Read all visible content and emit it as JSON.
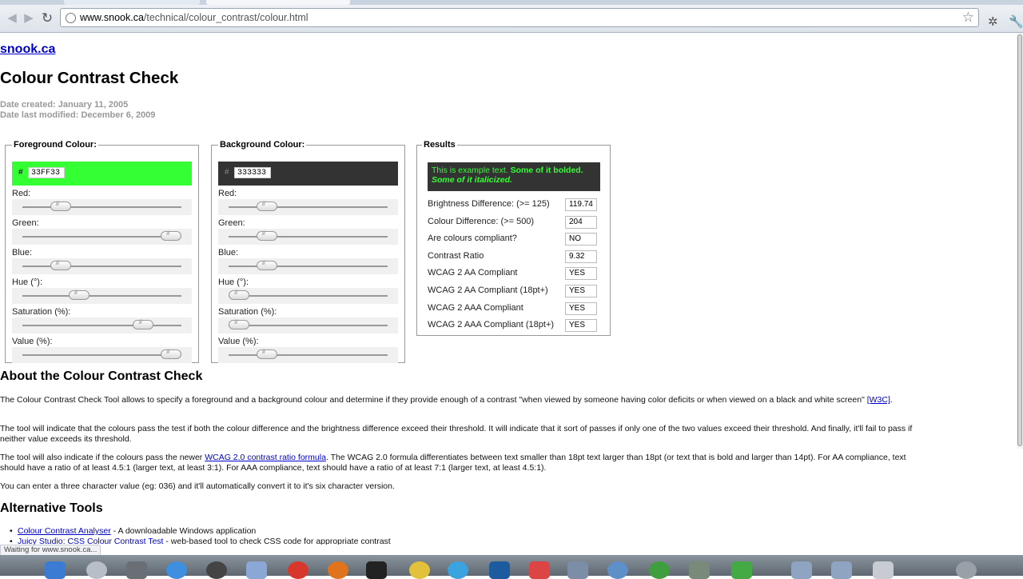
{
  "browser": {
    "url_host": "www.snook.ca",
    "url_path": "/technical/colour_contrast/colour.html",
    "status_text": "Waiting for www.snook.ca..."
  },
  "page": {
    "site_link": "snook.ca",
    "title": "Colour Contrast Check",
    "date_created": "Date created: January 11, 2005",
    "date_modified": "Date last modified: December 6, 2009"
  },
  "foreground": {
    "legend": "Foreground Colour:",
    "hash": "#",
    "hex": "33FF33",
    "color": "#33FF33",
    "sliders": [
      {
        "label": "Red:",
        "level": 0.2
      },
      {
        "label": "Green:",
        "level": 1.0
      },
      {
        "label": "Blue:",
        "level": 0.2
      },
      {
        "label": "Hue (°):",
        "level": 0.333
      },
      {
        "label": "Saturation (%):",
        "level": 0.8
      },
      {
        "label": "Value (%):",
        "level": 1.0
      }
    ]
  },
  "background": {
    "legend": "Background Colour:",
    "hash": "#",
    "hex": "333333",
    "color": "#333333",
    "sliders": [
      {
        "label": "Red:",
        "level": 0.2
      },
      {
        "label": "Green:",
        "level": 0.2
      },
      {
        "label": "Blue:",
        "level": 0.2
      },
      {
        "label": "Hue (°):",
        "level": 0
      },
      {
        "label": "Saturation (%):",
        "level": 0
      },
      {
        "label": "Value (%):",
        "level": 0.2
      }
    ]
  },
  "results": {
    "legend": "Results",
    "sample_plain": "This is example text.",
    "sample_bold": "Some of it bolded.",
    "sample_italic": "Some of it italicized.",
    "rows": [
      {
        "label": "Brightness Difference: (>= 125)",
        "value": "119.74"
      },
      {
        "label": "Colour Difference: (>= 500)",
        "value": "204"
      },
      {
        "label": "Are colours compliant?",
        "value": "NO"
      },
      {
        "label": "Contrast Ratio",
        "value": "9.32"
      },
      {
        "label": "WCAG 2 AA Compliant",
        "value": "YES"
      },
      {
        "label": "WCAG 2 AA Compliant (18pt+)",
        "value": "YES"
      },
      {
        "label": "WCAG 2 AAA Compliant",
        "value": "YES"
      },
      {
        "label": "WCAG 2 AAA Compliant (18pt+)",
        "value": "YES"
      }
    ]
  },
  "about": {
    "heading": "About the Colour Contrast Check",
    "p1_text": "The Colour Contrast Check Tool allows to specify a foreground and a background colour and determine if they provide enough of a contrast \"when viewed by someone having color deficits or when viewed on a black and white screen\"",
    "p1_link": "[W3C]",
    "p1_end": ".",
    "p2": "The tool will indicate that the colours pass the test if both the colour difference and the brightness difference exceed their threshold. It will indicate that it sort of passes if only one of the two values exceed their threshold. And finally, it'll fail to pass if neither value exceeds its threshold.",
    "p3_start": "The tool will also indicate if the colours pass the newer ",
    "p3_link": "WCAG 2.0 contrast ratio formula",
    "p3_end": ". The WCAG 2.0 formula differentiates between text smaller than 18pt text larger than 18pt (or text that is bold and larger than 14pt). For AA compliance, text should have a ratio of at least 4.5:1 (larger text, at least 3:1). For AAA compliance, text should have a ratio of at least 7:1 (larger text, at least 4.5:1).",
    "p4": "You can enter a three character value (eg: 036) and it'll automatically convert it to it's six character version."
  },
  "alt_tools": {
    "heading": "Alternative Tools",
    "items": [
      {
        "link": "Colour Contrast Analyser",
        "desc": " - A downloadable Windows application"
      },
      {
        "link": "Juicy Studio: CSS Colour Contrast Test",
        "desc": " - web-based tool to check CSS code for appropriate contrast"
      }
    ]
  },
  "colors": {
    "link": "#0000CC",
    "meta_gray": "#999999"
  }
}
